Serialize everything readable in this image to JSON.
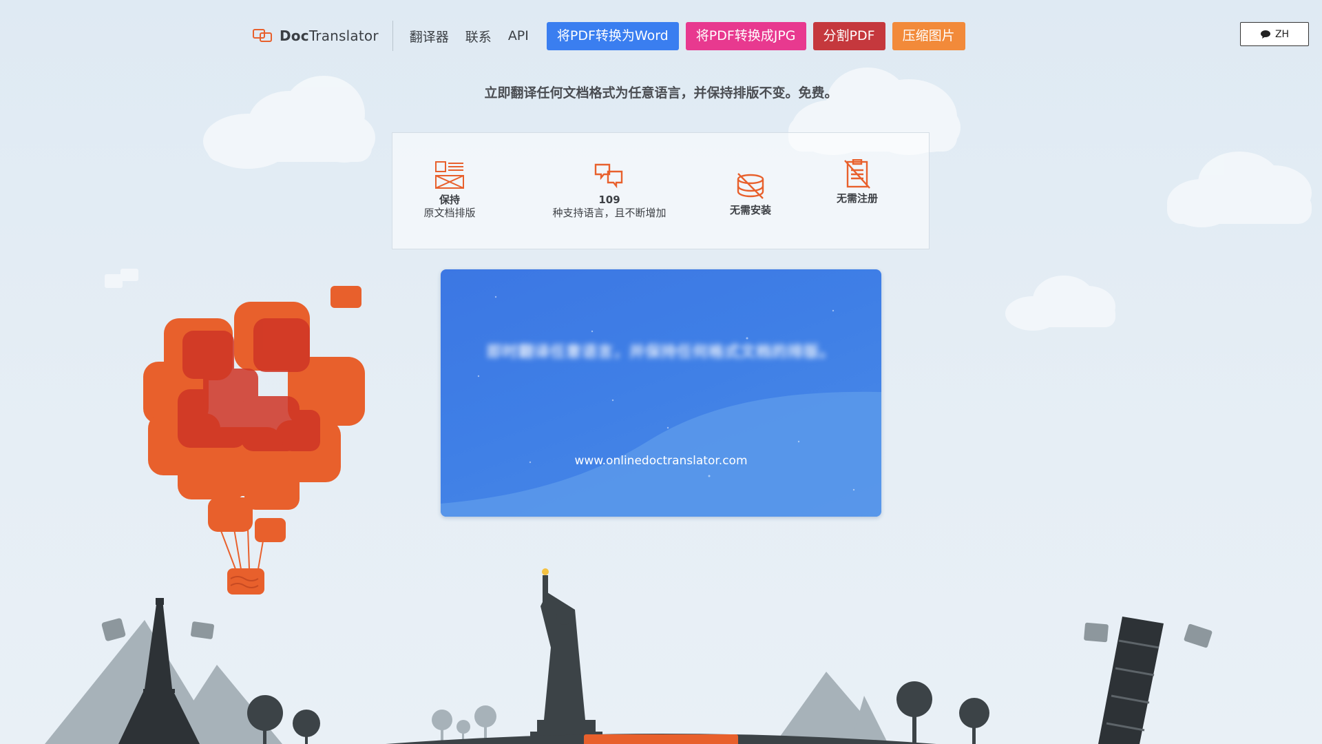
{
  "nav": {
    "brand_prefix": "Doc",
    "brand_suffix": "Translator",
    "links": [
      "翻译器",
      "联系",
      "API"
    ],
    "pills": [
      {
        "label": "将PDF转换为Word",
        "color": "#3a7ef0"
      },
      {
        "label": "将PDF转换成JPG",
        "color": "#e8398f"
      },
      {
        "label": "分割PDF",
        "color": "#c5383d"
      },
      {
        "label": "压缩图片",
        "color": "#f28a3a"
      }
    ],
    "lang": "ZH"
  },
  "tagline": "立即翻译任何文档格式为任意语言，并保持排版不变。免费。",
  "features": [
    {
      "icon": "layout-icon",
      "line1": "保持",
      "line2": "原文档排版"
    },
    {
      "icon": "translate-icon",
      "line1": "109",
      "line2": "种支持语言，且不断增加"
    },
    {
      "icon": "no-install-icon",
      "line1": "无需安装",
      "line2": ""
    },
    {
      "icon": "no-register-icon",
      "line1": "无需注册",
      "line2": ""
    }
  ],
  "card": {
    "blurred_text": "即时翻译任意语言，并保持任何格式文档的排版。",
    "url": "www.onlinedoctranslator.com"
  },
  "colors": {
    "accent_orange": "#e8602c",
    "card_blue": "#3f7fe6",
    "background": "#e3edf5"
  }
}
